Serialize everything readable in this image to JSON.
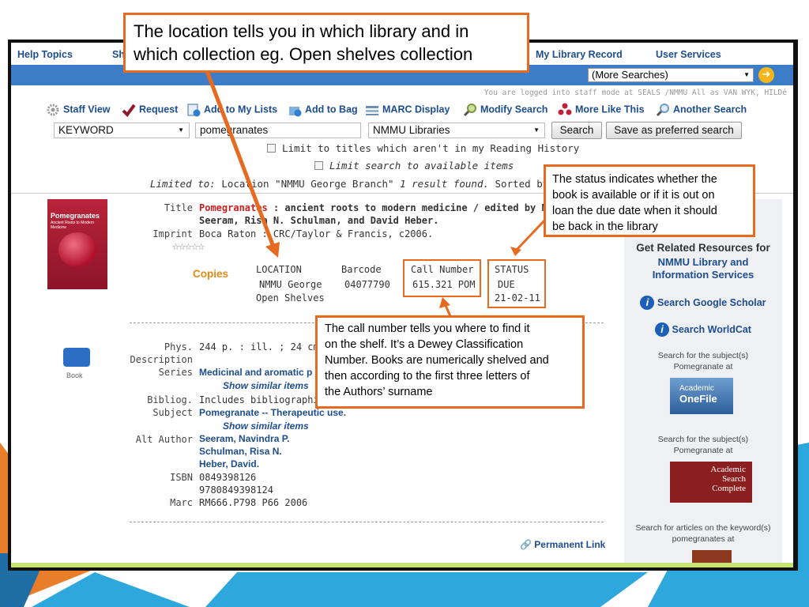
{
  "nav": {
    "help_topics": "Help Topics",
    "sh_fragment": "Sh",
    "my_library_record": "My Library Record",
    "user_services": "User Services"
  },
  "more_searches": "(More Searches)",
  "logged_in": "You are logged into staff mode at SEALS /NMMU All as VAN WYK, HILDé",
  "toolbar": {
    "staff_view": "Staff View",
    "request": "Request",
    "add_to_my_lists": "Add to My Lists",
    "add_to_bag": "Add to Bag",
    "marc_display": "MARC Display",
    "modify_search": "Modify Search",
    "more_like_this": "More Like This",
    "another_search": "Another Search"
  },
  "search": {
    "type": "KEYWORD",
    "query": "pomegranates",
    "scope": "NMMU Libraries",
    "search_button": "Search",
    "save_button": "Save as preferred search",
    "limit_reading": "Limit to titles which aren't in my Reading History",
    "limit_available": "Limit search to available items",
    "limited_prefix": "Limited to:",
    "limited_location": "Location \"NMMU George Branch\"",
    "result_count": "1 result found.",
    "sorted_by": "Sorted by Relevan"
  },
  "record": {
    "cover_title": "Pomegranates",
    "cover_subtitle": "Ancient Roots to Modern Medicine",
    "title_label": "Title",
    "title_highlight": "Pomegranates",
    "title_rest": ": ancient roots to modern medicine / edited by Navindra P",
    "title_line2": "Seeram, Risa N. Schulman, and David Heber.",
    "imprint_label": "Imprint",
    "imprint": "Boca Raton : CRC/Taylor & Francis, c2006.",
    "stars": "☆☆☆☆☆",
    "copies_label": "Copies",
    "copies_headers": [
      "LOCATION",
      "Barcode",
      "Call Number",
      "STATUS"
    ],
    "copies_row": {
      "location_1": "NMMU George",
      "location_2": "Open Shelves",
      "barcode": "04077790",
      "call_number": "615.321 POM",
      "status_1": "DUE",
      "status_2": "21-02-11"
    },
    "phys_label_1": "Phys.",
    "phys_label_2": "Description",
    "phys": "244 p. : ill. ; 24 cm.",
    "series_label": "Series",
    "series": "Medicinal and aromatic p",
    "show_similar": "Show similar items",
    "bibliog_label": "Bibliog.",
    "bibliog": "Includes bibliographical re",
    "subject_label": "Subject",
    "subject": "Pomegranate -- Therapeutic use.",
    "alt_author_label": "Alt Author",
    "alt_authors": [
      "Seeram, Navindra P.",
      "Schulman, Risa N.",
      "Heber, David."
    ],
    "isbn_label": "ISBN",
    "isbns": [
      "0849398126",
      "9780849398124"
    ],
    "marc_label": "Marc",
    "marc": "RM666.P798 P66 2006",
    "format": "Book",
    "permanent_link": "Permanent Link"
  },
  "sidebar": {
    "heading": "Get Related Resources for",
    "org_1": "NMMU Library and",
    "org_2": "Information Services",
    "google_scholar": "Search Google Scholar",
    "worldcat": "Search WorldCat",
    "subject_at_1": "Search for the subject(s)",
    "subject_at_2": "Pomegranate at",
    "onefile_1": "Academic",
    "onefile_2": "OneFile",
    "subject_at_3": "Search for the subject(s)",
    "subject_at_4": "Pomegranate at",
    "asc_1": "Academic",
    "asc_2": "Search",
    "asc_3": "Complete",
    "articles_1": "Search for articles on the keyword(s)",
    "articles_2": "pomegranates at"
  },
  "callouts": {
    "location_1": "The location tells you in which library and in",
    "location_2": "which collection eg. Open shelves collection",
    "status_1": "The status indicates whether the",
    "status_2": "book  is available or  if it is out on",
    "status_3": "loan the due date when it should",
    "status_4": "be back in the library",
    "call_1": "The call number tells  you where to find it",
    "call_2": "on the shelf. It’s a Dewey Classification",
    "call_3": "Number. Books are numerically shelved and",
    "call_4": "then according to the first three letters of",
    "call_5": "the Authors’ surname"
  },
  "colors": {
    "accent_orange": "#e66a1f",
    "nav_blue": "#3d7dc8",
    "link_blue": "#1d4d8f",
    "slide_cyan": "#2ea8dc"
  }
}
